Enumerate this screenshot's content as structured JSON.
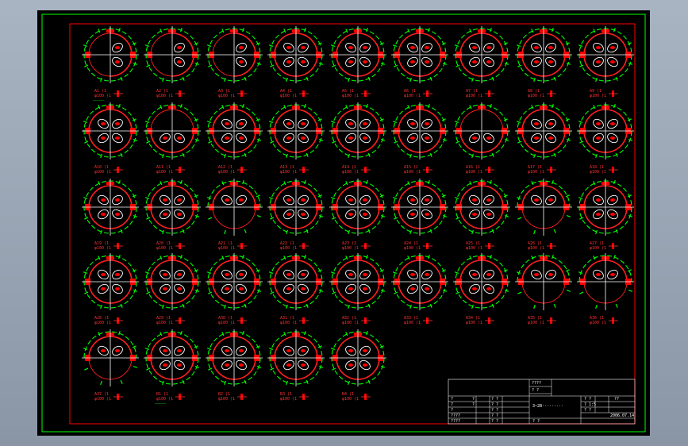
{
  "app": {
    "viewport": "cad-model-space"
  },
  "colors": {
    "background": "#000000",
    "outer_frame": "#00ff00",
    "inner_frame": "#ff0000",
    "circle_outline": "#ff2020",
    "dimension": "#00ff00",
    "hatch_fill": "#ff0000",
    "centerline": "#ffffff",
    "label_red": "#ff3030",
    "label_green": "#00ff00"
  },
  "icons": {
    "part_symbol": "flange-hole-pattern-icon",
    "fill_marker": "weld-block-icon"
  },
  "drawing_grid": {
    "rows": [
      [
        {
          "variant": "half",
          "label": "A1  (1",
          "sub": "φ100 (1",
          "note": "——————"
        },
        {
          "variant": "half",
          "label": "A2  (1",
          "sub": "φ100 (1",
          "note": ""
        },
        {
          "variant": "half",
          "label": "A3  (1",
          "sub": "φ100 (1",
          "note": ""
        },
        {
          "variant": "full",
          "label": "A4  (1",
          "sub": "φ100 (1",
          "note": ""
        },
        {
          "variant": "full",
          "label": "A5  (1",
          "sub": "φ100 (1",
          "note": ""
        },
        {
          "variant": "full",
          "label": "A6  (1",
          "sub": "φ100 (1",
          "note": ""
        },
        {
          "variant": "full",
          "label": "A7  (1",
          "sub": "φ100 (1",
          "note": ""
        },
        {
          "variant": "full",
          "label": "A8  (1",
          "sub": "φ100 (1",
          "note": ""
        },
        {
          "variant": "full",
          "label": "A9  (1",
          "sub": "φ100 (1",
          "note": ""
        }
      ],
      [
        {
          "variant": "full",
          "label": "A10  (1",
          "sub": "φ100 (1",
          "note": ""
        },
        {
          "variant": "lower",
          "label": "A11  (1",
          "sub": "φ100 (1",
          "note": ""
        },
        {
          "variant": "full",
          "label": "A12  (1",
          "sub": "φ100 (1",
          "note": ""
        },
        {
          "variant": "full",
          "label": "A13  (1",
          "sub": "φ100 (1",
          "note": ""
        },
        {
          "variant": "full",
          "label": "A14  (1",
          "sub": "φ100 (1",
          "note": ""
        },
        {
          "variant": "full",
          "label": "A15  (1",
          "sub": "φ100 (1",
          "note": ""
        },
        {
          "variant": "lower",
          "label": "A16  (1",
          "sub": "φ100 (1",
          "note": ""
        },
        {
          "variant": "full",
          "label": "A17  (1",
          "sub": "φ100 (1",
          "note": ""
        },
        {
          "variant": "full",
          "label": "A18  (1",
          "sub": "φ100 (1",
          "note": ""
        }
      ],
      [
        {
          "variant": "full",
          "label": "A19  (1",
          "sub": "φ100 (1",
          "note": ""
        },
        {
          "variant": "full",
          "label": "A20  (1",
          "sub": "φ100 (1",
          "note": ""
        },
        {
          "variant": "upper",
          "label": "A21  (1",
          "sub": "φ100 (1",
          "note": ""
        },
        {
          "variant": "full",
          "label": "A22  (1",
          "sub": "φ100 (1",
          "note": ""
        },
        {
          "variant": "full",
          "label": "A23  (1",
          "sub": "φ100 (1",
          "note": ""
        },
        {
          "variant": "full",
          "label": "A24  (1",
          "sub": "φ100 (1",
          "note": ""
        },
        {
          "variant": "full",
          "label": "A25  (1",
          "sub": "φ100 (1",
          "note": ""
        },
        {
          "variant": "upper",
          "label": "A26  (1",
          "sub": "φ100 (1",
          "note": ""
        },
        {
          "variant": "full",
          "label": "A27  (1",
          "sub": "φ100 (1",
          "note": ""
        }
      ],
      [
        {
          "variant": "full",
          "label": "A28  (1",
          "sub": "φ100 (1",
          "note": ""
        },
        {
          "variant": "full",
          "label": "A29  (1",
          "sub": "φ100 (1",
          "note": ""
        },
        {
          "variant": "full",
          "label": "A30  (1",
          "sub": "φ100 (1",
          "note": ""
        },
        {
          "variant": "full",
          "label": "A31  (1",
          "sub": "φ100 (1",
          "note": ""
        },
        {
          "variant": "full",
          "label": "A32  (1",
          "sub": "φ100 (1",
          "note": ""
        },
        {
          "variant": "full",
          "label": "A33  (1",
          "sub": "φ100 (1",
          "note": ""
        },
        {
          "variant": "full",
          "label": "A34  (1",
          "sub": "φ100 (1",
          "note": ""
        },
        {
          "variant": "upper",
          "label": "A35  (1",
          "sub": "φ100 (1",
          "note": ""
        },
        {
          "variant": "upper",
          "label": "A36  (1",
          "sub": "φ100 (1",
          "note": ""
        }
      ],
      [
        {
          "variant": "upper",
          "label": "A37  (1",
          "sub": "φ100 (1",
          "note": ""
        },
        {
          "variant": "full",
          "label": "B1  (1",
          "sub": "φ100 (1",
          "note": "——————"
        },
        {
          "variant": "full",
          "label": "B2  (1",
          "sub": "φ100 (1",
          "note": ""
        },
        {
          "variant": "full",
          "label": "B3  (1",
          "sub": "φ100 (1",
          "note": ""
        },
        {
          "variant": "full",
          "label": "B4  (1",
          "sub": "φ100 (1",
          "note": ""
        }
      ]
    ]
  },
  "title_block": {
    "header_cell": "????",
    "header_cell_2": "? ?",
    "drawing_title": "3~2B·········",
    "q": "?",
    "qq": "? ?",
    "scale": "? 1:5",
    "sheet": "? ?",
    "count": "??",
    "date": "2006.07.14",
    "designer": "????",
    "checker": "????"
  }
}
